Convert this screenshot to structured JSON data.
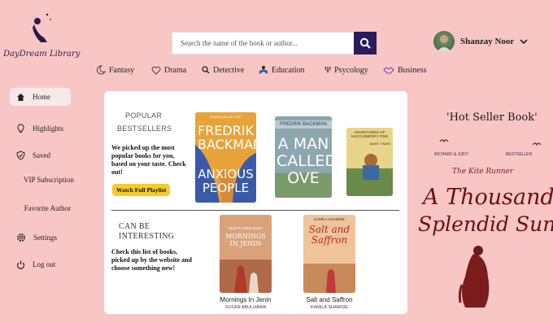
{
  "brand": {
    "name": "DayDream Library"
  },
  "search": {
    "placeholder": "Search the name of the book or author..."
  },
  "user": {
    "name": "Shanzay Noor"
  },
  "categories": [
    {
      "label": "Fantasy",
      "icon": "moon-icon"
    },
    {
      "label": "Drama",
      "icon": "heart-icon"
    },
    {
      "label": "Detective",
      "icon": "magnifier-icon"
    },
    {
      "label": "Education",
      "icon": "reader-icon"
    },
    {
      "label": "Psycology",
      "icon": "psi-icon"
    },
    {
      "label": "Business",
      "icon": "handshake-icon"
    }
  ],
  "sidebar": {
    "items": [
      {
        "label": "Home",
        "icon": "home-icon"
      },
      {
        "label": "Highlights",
        "icon": "bulb-icon"
      },
      {
        "label": "Saved",
        "icon": "shield-icon"
      },
      {
        "label": "VIP Subscription",
        "icon": "crown-icon"
      },
      {
        "label": "Favorite Author",
        "icon": "person-icon"
      },
      {
        "label": "Settings",
        "icon": "gear-icon"
      },
      {
        "label": "Log out",
        "icon": "power-icon"
      }
    ]
  },
  "bestsellers": {
    "title_line1": "POPULAR",
    "title_line2": "BESTSELLERS",
    "description": "We picked up the most popular books for you, based on your taste. Check out!",
    "button_label": "Watch Full Playlist",
    "books": [
      {
        "cover_author": "FREDRIK BACKMAN",
        "cover_title": "ANXIOUS PEOPLE",
        "cover_tag": "A MAN CALLED OVE",
        "color": "#e9a53a"
      },
      {
        "cover_author": "FREDRIK BACKMAN",
        "cover_title": "A MAN CALLED OVE",
        "color": "#8fa8b0"
      },
      {
        "cover_title": "ADVENTURES OF HUCKLEBERRY FINN",
        "cover_author": "MARK TWAIN",
        "color": "#d8c46a"
      }
    ]
  },
  "interesting": {
    "title_line1": "CAN BE",
    "title_line2": "INTERESTING",
    "description": "Check this list of books, picked up by the website and choose something new!",
    "books": [
      {
        "title": "Mornings In Jenin",
        "author": "SUSAN ABULHAWA",
        "cover_author": "SUSAN ABULHAWA",
        "cover_title": "MORNINGS IN JENIN",
        "color": "#c98a5a"
      },
      {
        "title": "Salt and Saffron",
        "author": "KAMILA SHAMSIE",
        "cover_author": "KAMILA SHAMSIE",
        "cover_title": "Salt and Saffron",
        "color": "#e9b08a"
      }
    ]
  },
  "hot_seller": {
    "heading": "'Hot Seller Book'",
    "small_left": "RICHARD & JUDY",
    "small_right": "BESTSELLER",
    "by_line": "The Kite Runner",
    "title_line1": "A Thousand",
    "title_line2": "Splendid Suns"
  }
}
